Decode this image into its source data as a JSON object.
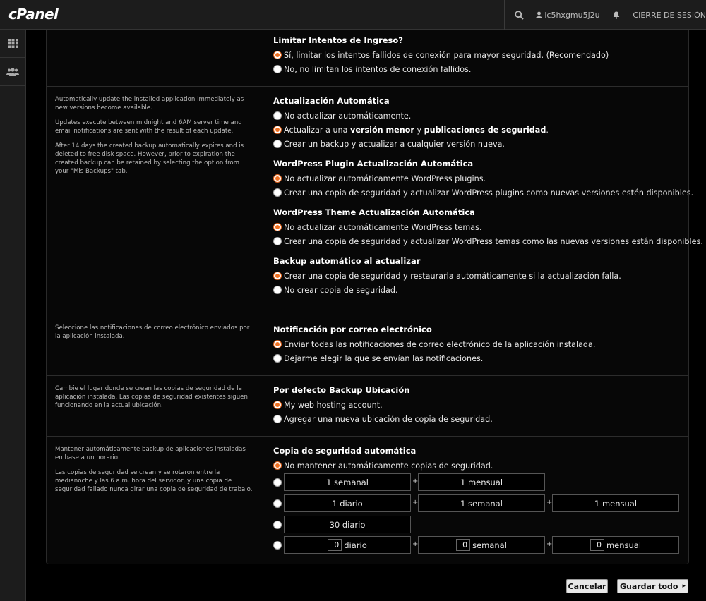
{
  "topbar": {
    "logo": "cPanel",
    "username": "ic5hxgmu5j2u",
    "logout_label": "CIERRE DE SESIÓN",
    "search_icon": "search-icon",
    "bell_icon": "bell-icon"
  },
  "sidebar": {
    "items": [
      {
        "icon": "grid-icon"
      },
      {
        "icon": "users-icon"
      }
    ]
  },
  "login_limit": {
    "heading": "Limitar Intentos de Ingreso?",
    "opt1": "Sí, limitar los intentos fallidos de conexión para mayor seguridad. (Recomendado)",
    "opt2": "No, no limitan los intentos de conexión fallidos."
  },
  "auto_update": {
    "help1": "Automatically update the installed application immediately as new versions become available.",
    "help2": "Updates execute between midnight and 6AM server time and email notifications are sent with the result of each update.",
    "help3": "After 14 days the created backup automatically expires and is deleted to free disk space. However, prior to expiration the created backup can be retained by selecting the option from your \"Mis Backups\" tab.",
    "heading": "Actualización Automática",
    "opt1": "No actualizar automáticamente.",
    "opt2_a": "Actualizar a una ",
    "opt2_b": "versión menor",
    "opt2_c": " y ",
    "opt2_d": "publicaciones de seguridad",
    "opt2_e": ".",
    "opt3": "Crear un backup y actualizar a cualquier versión nueva.",
    "plugin_heading": "WordPress Plugin Actualización Automática",
    "plugin_opt1": "No actualizar automáticamente WordPress plugins.",
    "plugin_opt2": "Crear una copia de seguridad y actualizar WordPress plugins como nuevas versiones estén disponibles.",
    "theme_heading": "WordPress Theme Actualización Automática",
    "theme_opt1": "No actualizar automáticamente WordPress temas.",
    "theme_opt2": "Crear una copia de seguridad y actualizar WordPress temas como las nuevas versiones están disponibles.",
    "backup_heading": "Backup automático al actualizar",
    "backup_opt1": "Crear una copia de seguridad y restaurarla automáticamente si la actualización falla.",
    "backup_opt2": "No crear copia de seguridad."
  },
  "email": {
    "help": "Seleccione las notificaciones de correo electrónico enviados por la aplicación instalada.",
    "heading": "Notificación por correo electrónico",
    "opt1": "Enviar todas las notificaciones de correo electrónico de la aplicación instalada.",
    "opt2": "Dejarme elegir la que se envían las notificaciones."
  },
  "location": {
    "help": "Cambie el lugar donde se crean las copias de seguridad de la aplicación instalada. Las copias de seguridad existentes siguen funcionando en la actual ubicación.",
    "heading": "Por defecto Backup Ubicación",
    "opt1": "My web hosting account.",
    "opt2": "Agregar una nueva ubicación de copia de seguridad."
  },
  "auto_backup": {
    "help1": "Mantener automáticamente backup de aplicaciones instaladas en base a un horario.",
    "help2": "Las copias de seguridad se crean y se rotaron entre la medianoche y las 6 a.m. hora del servidor, y una copia de seguridad fallado nunca girar una copia de seguridad de trabajo.",
    "heading": "Copia de seguridad automática",
    "opt1": "No mantener automáticamente copias de seguridad.",
    "plus": "+",
    "row1": [
      "1 semanal",
      "1 mensual"
    ],
    "row2": [
      "1 diario",
      "1 semanal",
      "1 mensual"
    ],
    "row3": [
      "30 diario"
    ],
    "custom": {
      "daily_value": "0",
      "daily_label": "diario",
      "weekly_value": "0",
      "weekly_label": "semanal",
      "monthly_value": "0",
      "monthly_label": "mensual"
    }
  },
  "actions": {
    "cancel": "Cancelar",
    "save": "Guardar todo",
    "save_arrow": "▸"
  },
  "colors": {
    "accent": "#f07020",
    "background": "#000000",
    "bar": "#1c1c1c"
  }
}
